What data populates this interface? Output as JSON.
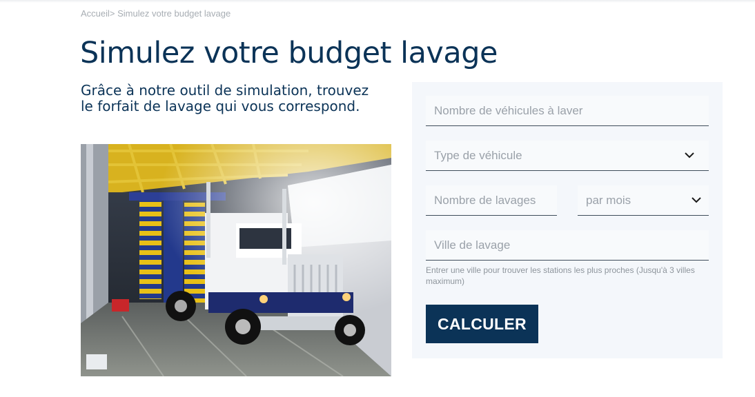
{
  "breadcrumb": {
    "home": "Accueil",
    "separator": ">",
    "current": " Simulez votre budget lavage"
  },
  "page": {
    "title": "Simulez votre budget lavage",
    "subtitle": "Grâce à notre outil de simulation, trouvez le forfait de lavage qui vous correspond."
  },
  "form": {
    "vehicles_count_placeholder": "Nombre de véhicules à laver",
    "vehicle_type_placeholder": "Type de véhicule",
    "washes_count_placeholder": "Nombre de lavages",
    "period_selected": "par mois",
    "city_placeholder": "Ville de lavage",
    "city_hint": "Entrer une ville pour trouver les stations les plus proches (Jusqu'à 3 villes maximum)",
    "submit_label": "CALCULER"
  },
  "colors": {
    "brand": "#0b3357",
    "panel_bg": "#f4f7fb",
    "muted": "#9aa1a9"
  }
}
